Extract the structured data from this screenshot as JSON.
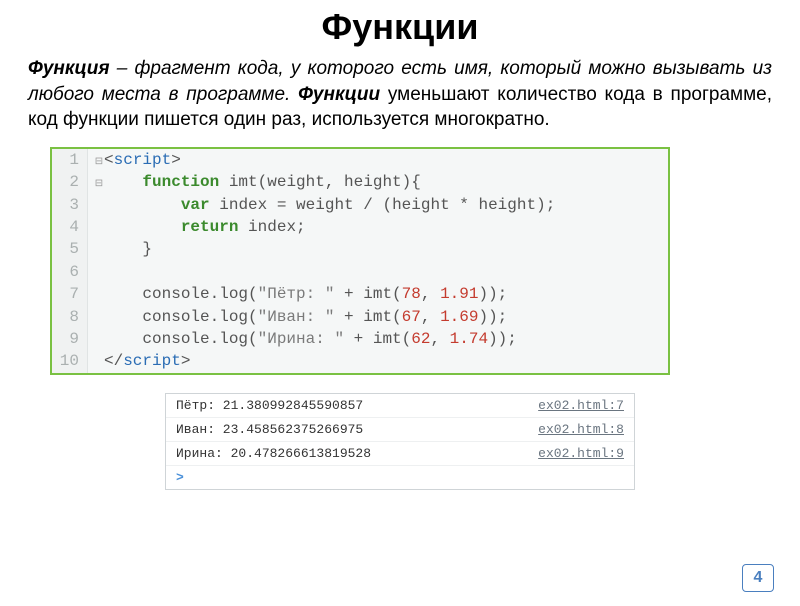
{
  "title": "Функции",
  "paragraph": {
    "term": "Функция",
    "after_term": " – фрагмент кода, у которого есть имя, который можно вызывать из любого места в программе.  ",
    "emph": "Функции",
    "rest": " уменьшают количество кода в программе, код функции пишется один раз, используется многократно."
  },
  "code": {
    "lines": [
      {
        "n": "1",
        "fold": "⊟",
        "html": "<span class='plain'>&lt;</span><span class='tag-blue'>script</span><span class='plain'>&gt;</span>"
      },
      {
        "n": "2",
        "fold": "⊟",
        "html": "    <span class='kw-green'>function</span> <span class='plain'>imt(weight, height){</span>"
      },
      {
        "n": "3",
        "fold": "",
        "html": "        <span class='kw-green'>var</span> <span class='plain'>index = weight / (height * height);</span>"
      },
      {
        "n": "4",
        "fold": "",
        "html": "        <span class='ret-green'>return</span> <span class='plain'>index;</span>"
      },
      {
        "n": "5",
        "fold": "",
        "html": "    <span class='plain'>}</span>"
      },
      {
        "n": "6",
        "fold": "",
        "html": ""
      },
      {
        "n": "7",
        "fold": "",
        "html": "    <span class='plain'>console.log(</span><span class='str-gray'>\"Пётр: \"</span><span class='plain'> + imt(</span><span class='num-red'>78</span><span class='plain'>, </span><span class='num-red'>1.91</span><span class='plain'>));</span>"
      },
      {
        "n": "8",
        "fold": "",
        "html": "    <span class='plain'>console.log(</span><span class='str-gray'>\"Иван: \"</span><span class='plain'> + imt(</span><span class='num-red'>67</span><span class='plain'>, </span><span class='num-red'>1.69</span><span class='plain'>));</span>"
      },
      {
        "n": "9",
        "fold": "",
        "html": "    <span class='plain'>console.log(</span><span class='str-gray'>\"Ирина: \"</span><span class='plain'> + imt(</span><span class='num-red'>62</span><span class='plain'>, </span><span class='num-red'>1.74</span><span class='plain'>));</span>"
      },
      {
        "n": "10",
        "fold": "",
        "html": "<span class='plain'>&lt;/</span><span class='tag-blue'>script</span><span class='plain'>&gt;</span>"
      }
    ]
  },
  "console": {
    "rows": [
      {
        "text": "Пётр: 21.380992845590857",
        "src": "ex02.html:7"
      },
      {
        "text": "Иван: 23.458562375266975",
        "src": "ex02.html:8"
      },
      {
        "text": "Ирина: 20.478266613819528",
        "src": "ex02.html:9"
      }
    ],
    "prompt": ">"
  },
  "page_number": "4"
}
